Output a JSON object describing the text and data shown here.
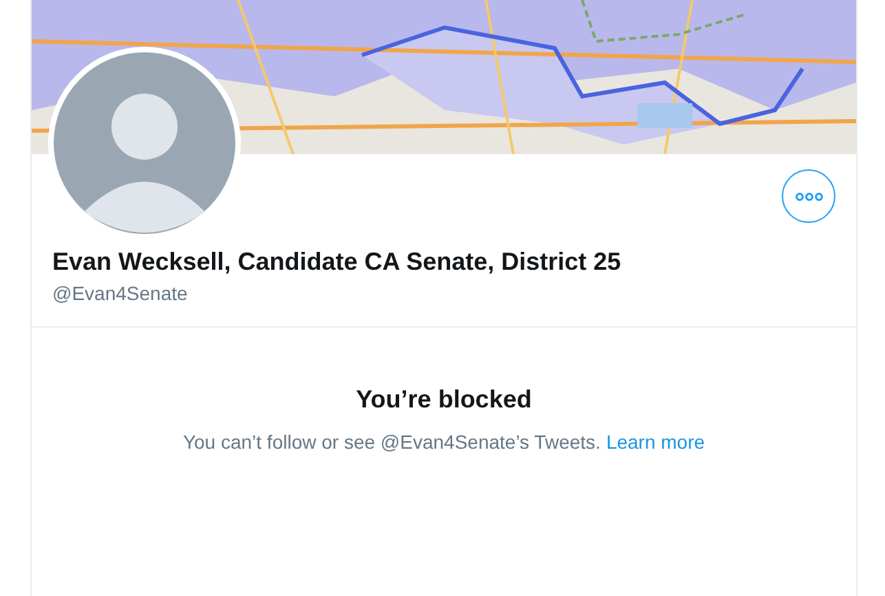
{
  "profile": {
    "name": "Evan Wecksell, Candidate CA Senate, District 25",
    "handle": "@Evan4Senate"
  },
  "blocked": {
    "title": "You’re blocked",
    "message": "You can’t follow or see @Evan4Senate’s Tweets.",
    "link": "Learn more"
  }
}
